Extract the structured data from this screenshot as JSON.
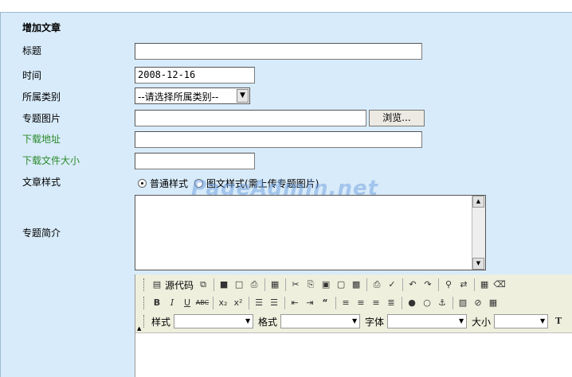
{
  "form": {
    "title": "增加文章",
    "labels": {
      "title": "标题",
      "time": "时间",
      "category": "所属类别",
      "image": "专题图片",
      "download_url": "下载地址",
      "download_size": "下载文件大小",
      "style": "文章样式",
      "summary": "专题简介"
    },
    "time_value": "2008-12-16",
    "category_selected": "--请选择所属类别--",
    "browse_label": "浏览...",
    "style_options": [
      "普通样式",
      "图文样式(需上传专题图片)"
    ],
    "style_selected": 0
  },
  "watermark": "PageAdmin.net",
  "editor": {
    "source_label": "源代码",
    "combos": [
      "样式",
      "格式",
      "字体",
      "大小"
    ]
  },
  "colors": {
    "panel_bg": "#d8ebfa",
    "green_label": "#2a8a2a",
    "toolbar_bg": "#efefde"
  }
}
